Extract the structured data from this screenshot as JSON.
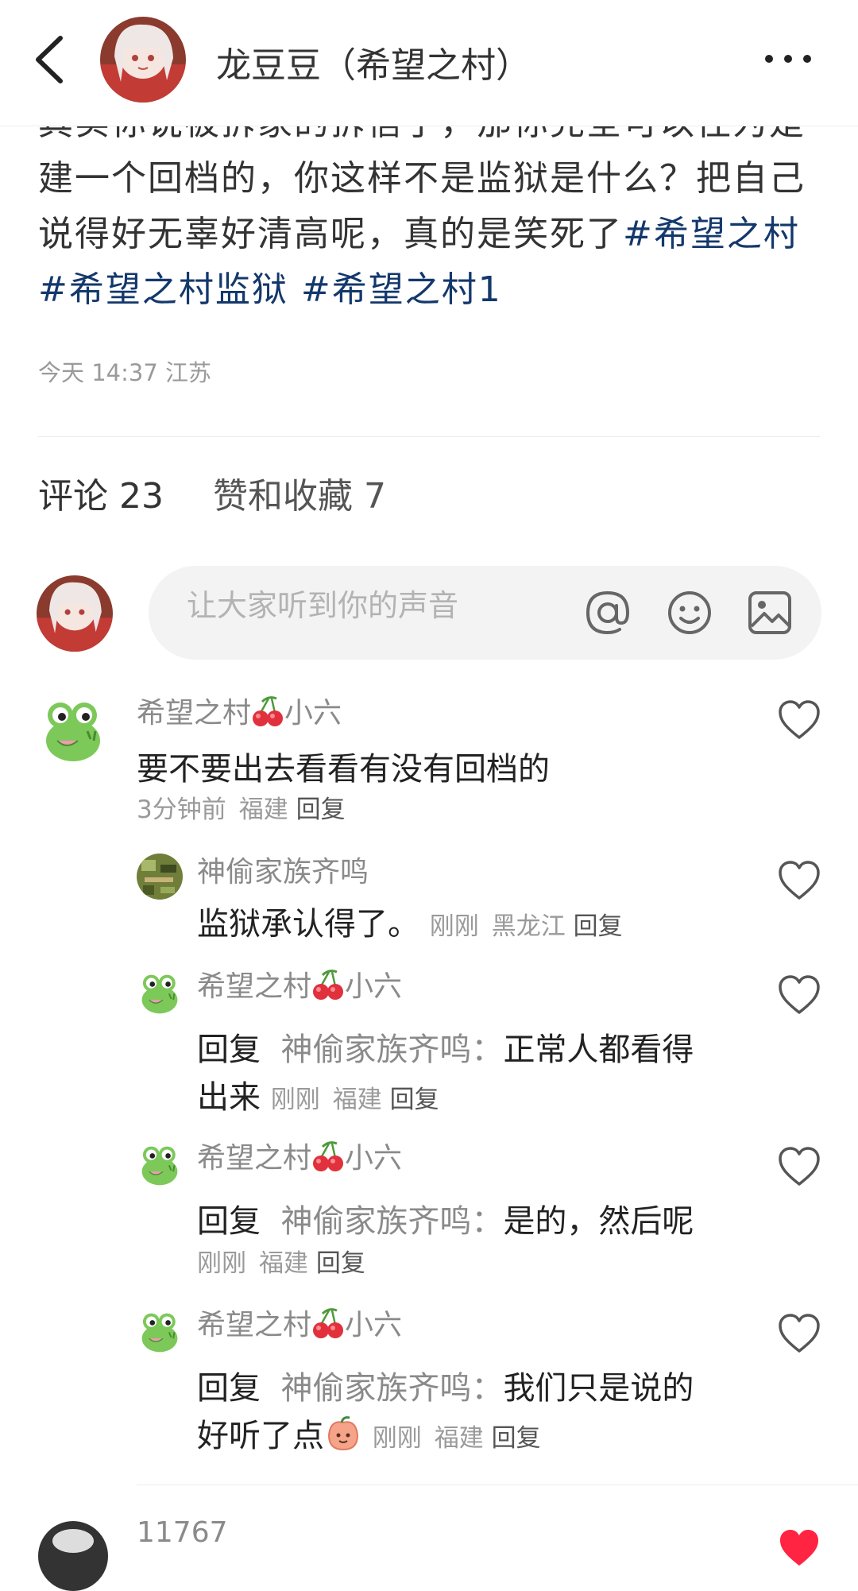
{
  "header": {
    "author_name": "龙豆豆（希望之村）"
  },
  "post": {
    "lines": [
      "其实你说被拆家的拆信了，那你完全可以往为是",
      "建一个回档的，你这样不是监狱是什么？把自己",
      "说得好无辜好清高呢，真的是笑死了"
    ],
    "inline_tag": "#希望之村",
    "tags": [
      "#希望之村监狱",
      "#希望之村1"
    ],
    "meta": "今天 14:37 江苏"
  },
  "tabs": {
    "comments": "评论 23",
    "likes": "赞和收藏 7"
  },
  "composer": {
    "placeholder": "让大家听到你的声音"
  },
  "comments": [
    {
      "user_prefix": "希望之村",
      "user_suffix": "小六",
      "text": "要不要出去看看有没有回档的",
      "time": "3分钟前",
      "location": "福建",
      "reply": "回复"
    },
    {
      "user": "神偷家族齐鸣",
      "text": "监狱承认得了。",
      "time": "刚刚",
      "location": "黑龙江",
      "reply": "回复"
    },
    {
      "user_prefix": "希望之村",
      "user_suffix": "小六",
      "reply_word": "回复",
      "mention": "神偷家族齐鸣：",
      "text_line1": "正常人都看得",
      "text_line2": "出来",
      "time": "刚刚",
      "location": "福建",
      "reply": "回复"
    },
    {
      "user_prefix": "希望之村",
      "user_suffix": "小六",
      "reply_word": "回复",
      "mention": "神偷家族齐鸣：",
      "text_line1": "是的，然后呢",
      "time": "刚刚",
      "location": "福建",
      "reply": "回复"
    },
    {
      "user_prefix": "希望之村",
      "user_suffix": "小六",
      "reply_word": "回复",
      "mention": "神偷家族齐鸣：",
      "text_line1": "我们只是说的",
      "text_line2": "好听了点",
      "time": "刚刚",
      "location": "福建",
      "reply": "回复"
    }
  ],
  "next_comment": {
    "user": "11767"
  },
  "colors": {
    "hashtag": "#13386c",
    "muted": "#9a9a9a",
    "composer_bg": "#f3f3f3",
    "like_red": "#ff2442"
  }
}
